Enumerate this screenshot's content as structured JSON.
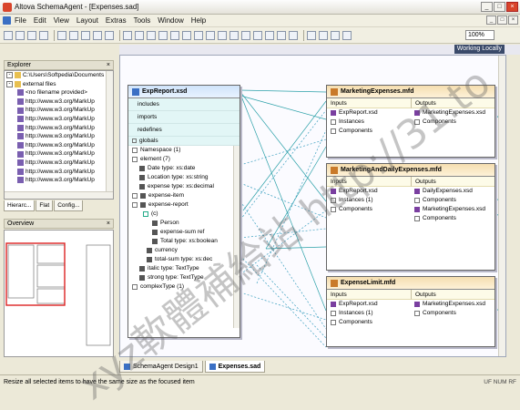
{
  "window": {
    "title": "Altova SchemaAgent - [Expenses.sad]",
    "buttons": [
      "_",
      "□",
      "×"
    ]
  },
  "menu": {
    "items": [
      "File",
      "Edit",
      "View",
      "Layout",
      "Extras",
      "Tools",
      "Window",
      "Help"
    ]
  },
  "toolbar": {
    "zoom": "100%"
  },
  "canvas_header": {
    "info": "Working Locally"
  },
  "explorer": {
    "title": "Explorer",
    "items": [
      "C:\\Users\\Softpedia\\Documents",
      "external files",
      "<no filename provided>",
      "http://www.w3.org/MarkUp",
      "http://www.w3.org/MarkUp",
      "http://www.w3.org/MarkUp",
      "http://www.w3.org/MarkUp",
      "http://www.w3.org/MarkUp",
      "http://www.w3.org/MarkUp",
      "http://www.w3.org/MarkUp",
      "http://www.w3.org/MarkUp",
      "http://www.w3.org/MarkUp",
      "http://www.w3.org/MarkUp"
    ],
    "tabs": [
      "Hierarc...",
      "Flat",
      "Config..."
    ]
  },
  "overview": {
    "title": "Overview"
  },
  "schema_box": {
    "title": "ExpReport.xsd",
    "sections": [
      "includes",
      "imports",
      "redefines"
    ],
    "globals_label": "globals",
    "rows": [
      "Namespace (1)",
      "element (7)",
      "Date  type: xs:date",
      "Location  type: xs:string",
      "expense  type: xs:decimal",
      "expense-item",
      "expense-report",
      "(c)",
      "Person",
      "expense-sum  ref",
      "Total  type: xs:boolean",
      "currency",
      "total-sum  type: xs:dec",
      "italic  type: TextType",
      "strong  type: TextType",
      "complexType (1)"
    ]
  },
  "mfd_boxes": [
    {
      "title": "MarketingExpenses.mfd",
      "inputs_label": "Inputs",
      "outputs_label": "Outputs",
      "inputs": [
        "ExpReport.xsd",
        "Instances",
        "Components"
      ],
      "outputs": [
        "MarketingExpenses.xsd",
        "Components"
      ]
    },
    {
      "title": "MarketingAndDailyExpenses.mfd",
      "inputs_label": "Inputs",
      "outputs_label": "Outputs",
      "inputs": [
        "ExpReport.xsd",
        "Instances (1)",
        "Components"
      ],
      "outputs": [
        "DailyExpenses.xsd",
        "Components",
        "MarketingExpenses.xsd",
        "Components"
      ]
    },
    {
      "title": "ExpenseLimit.mfd",
      "inputs_label": "Inputs",
      "outputs_label": "Outputs",
      "inputs": [
        "ExpReport.xsd",
        "Instances (1)",
        "Components"
      ],
      "outputs": [
        "MarketingExpenses.xsd",
        "Components"
      ]
    }
  ],
  "doc_tabs": [
    "SchemaAgent Design1",
    "Expenses.sad"
  ],
  "status": {
    "message": "Resize all selected items to have the same size as the focused item",
    "indicators": "UF  NUM  RF"
  },
  "watermark_text": "xyz軟體補給站 http://31.to"
}
